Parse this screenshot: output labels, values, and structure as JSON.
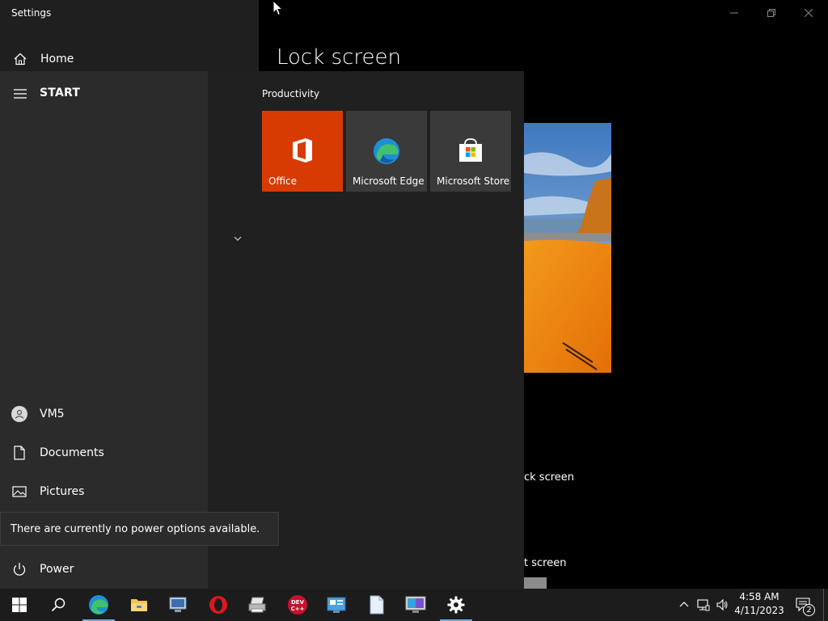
{
  "window": {
    "title": "Settings",
    "home_label": "Home",
    "page_heading": "Lock screen",
    "preview_caption_1": "ck screen",
    "preview_caption_2": "t screen"
  },
  "start_menu": {
    "header": "START",
    "left_items": [
      {
        "label": "VM5",
        "icon": "user-avatar-icon"
      },
      {
        "label": "Documents",
        "icon": "document-icon"
      },
      {
        "label": "Pictures",
        "icon": "pictures-icon"
      },
      {
        "label": "Power",
        "icon": "power-icon"
      }
    ],
    "tooltip": "There are currently no power options available.",
    "group_title": "Productivity",
    "tiles": [
      {
        "label": "Office",
        "icon": "office-icon",
        "color": "#d83b01"
      },
      {
        "label": "Microsoft Edge",
        "icon": "edge-icon"
      },
      {
        "label": "Microsoft Store",
        "icon": "store-icon"
      }
    ]
  },
  "taskbar": {
    "apps": [
      "start-button",
      "search",
      "microsoft-edge",
      "file-explorer",
      "network-app",
      "opera",
      "printer-app",
      "dev-cpp",
      "control-panel",
      "notepad",
      "display-app",
      "settings"
    ],
    "time": "4:58 AM",
    "date": "4/11/2023",
    "notification_count": "2",
    "accent": "#77a9d9"
  }
}
